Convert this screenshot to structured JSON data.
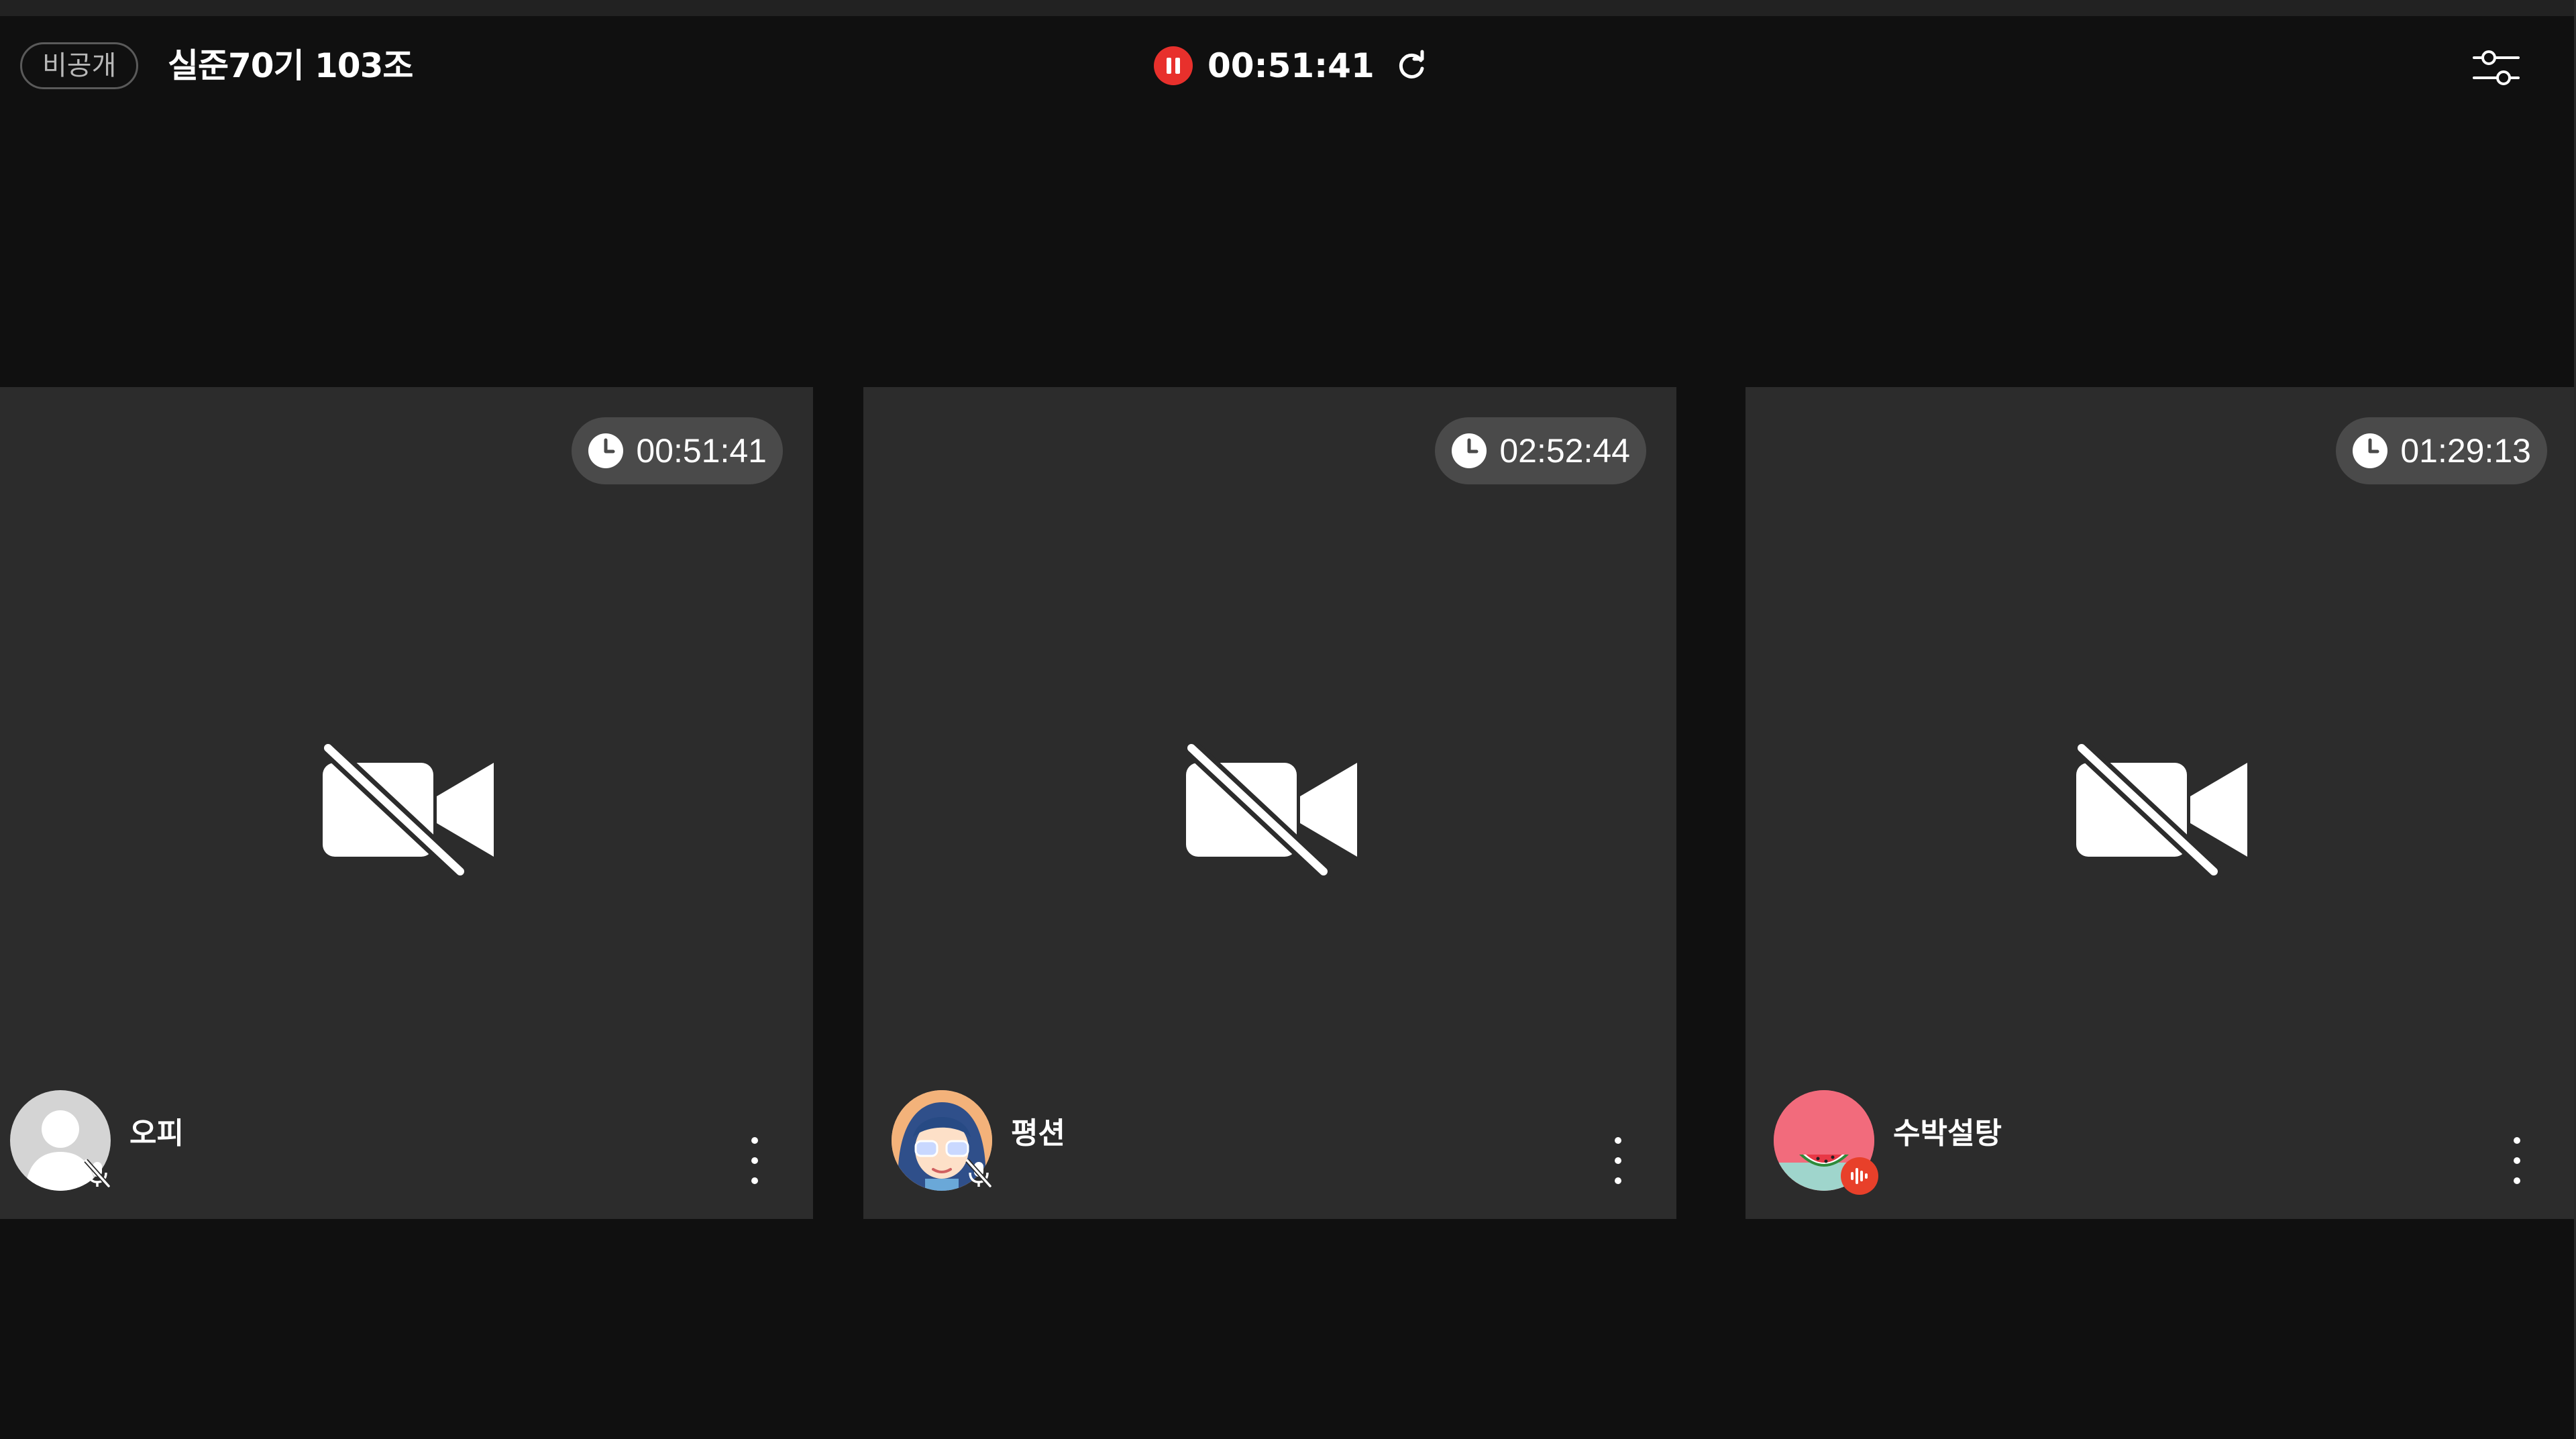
{
  "header": {
    "visibility_badge": "비공개",
    "room_title": "실준70기 103조",
    "recording_time": "00:51:41",
    "icons": {
      "pause": "pause-icon",
      "refresh": "refresh-icon",
      "settings": "sliders-icon"
    }
  },
  "participants": [
    {
      "name": "오피",
      "timer": "00:51:41",
      "camera": "off",
      "mic": "muted",
      "avatar": "default-person-avatar"
    },
    {
      "name": "평션",
      "timer": "02:52:44",
      "camera": "off",
      "mic": "muted",
      "avatar": "character-avatar"
    },
    {
      "name": "수박설탕",
      "timer": "01:29:13",
      "camera": "off",
      "mic": "speaking",
      "avatar": "watermelon-avatar"
    }
  ],
  "colors": {
    "background": "#101010",
    "tile": "#2c2c2c",
    "timer_pill": "#4a4a4a",
    "record_red": "#e8302c",
    "speaking_badge": "#e8402a"
  }
}
